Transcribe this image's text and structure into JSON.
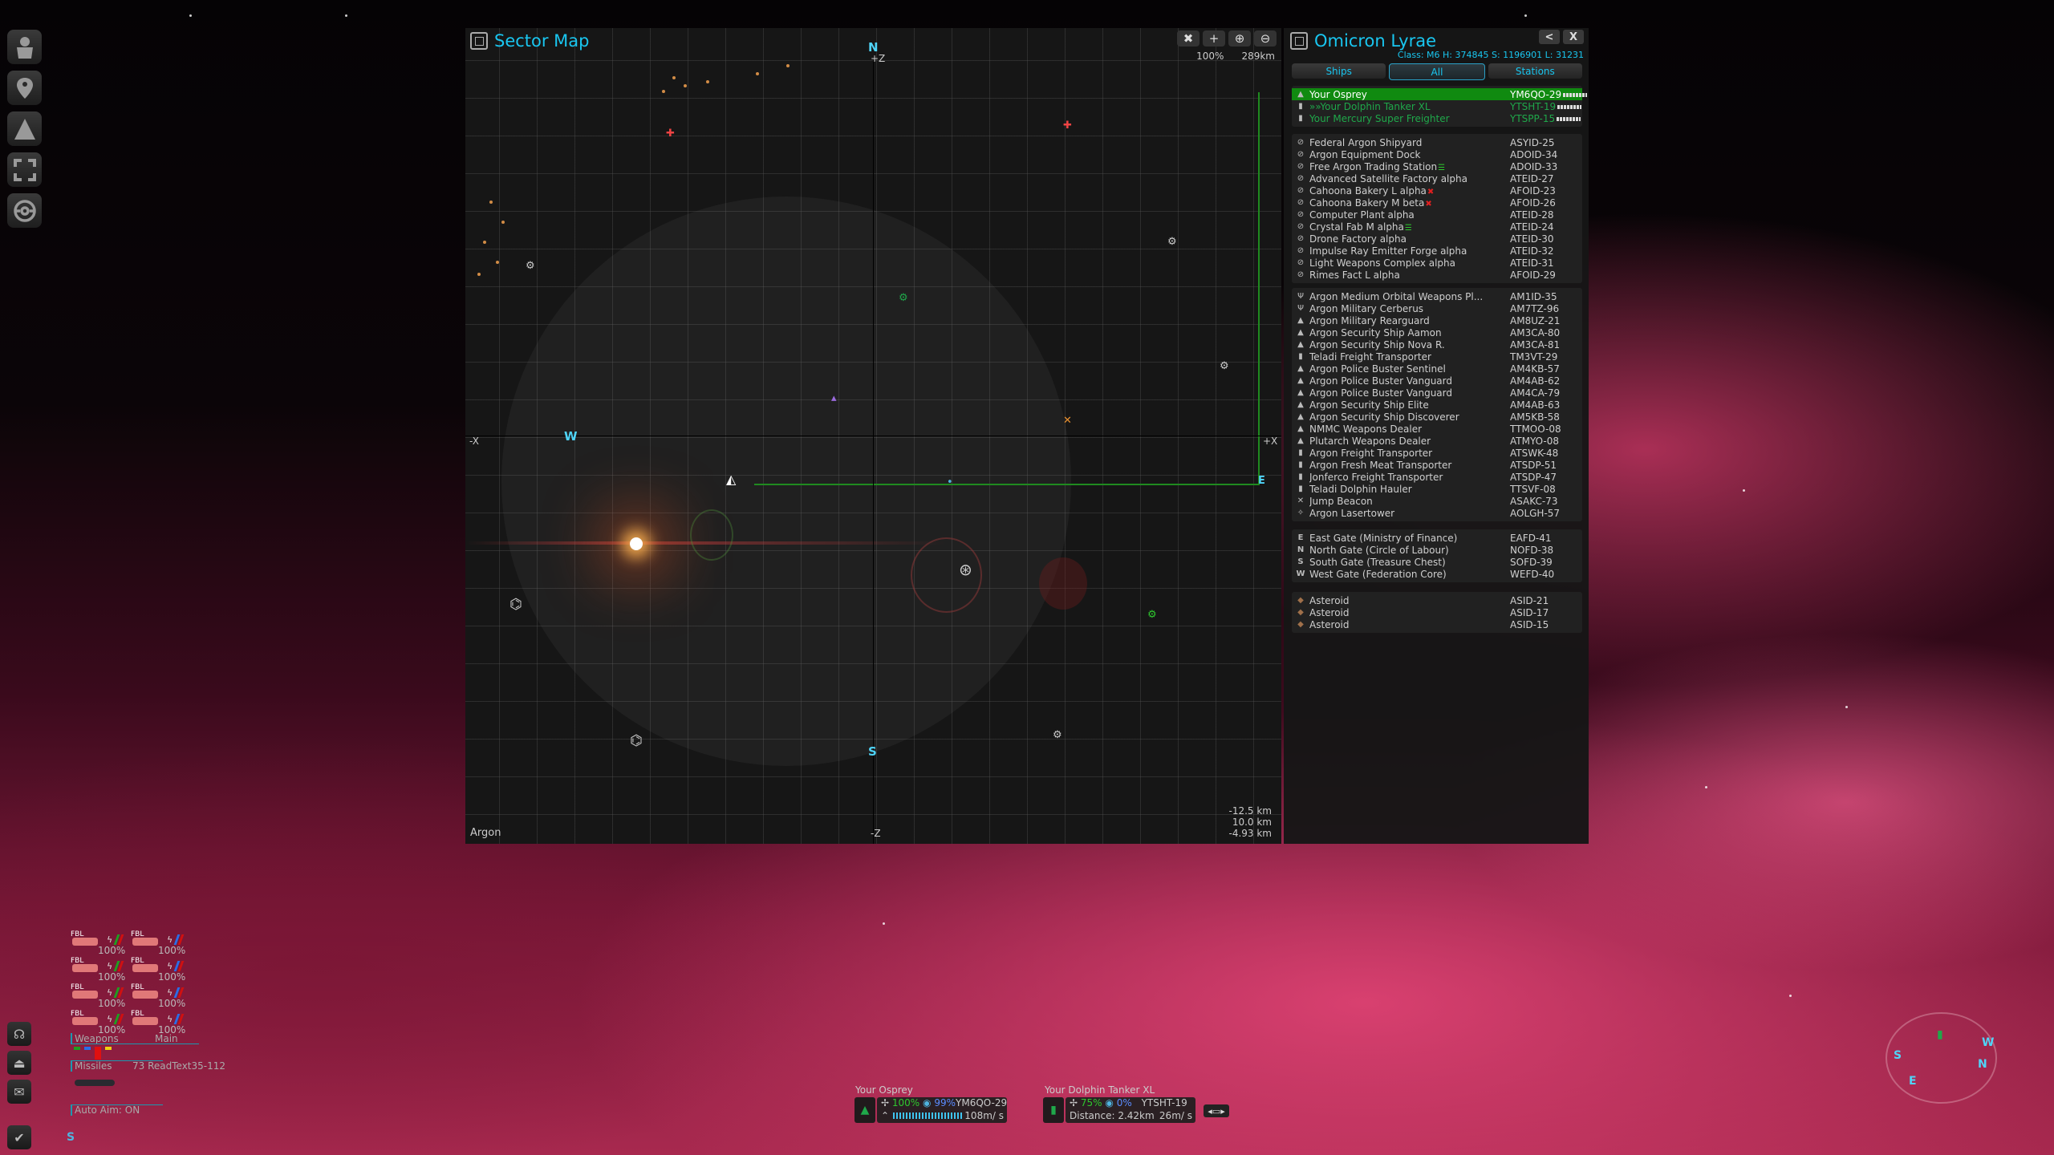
{
  "left_toolbar": [
    {
      "name": "pilot-icon"
    },
    {
      "name": "map-pin-icon"
    },
    {
      "name": "triangle-icon"
    },
    {
      "name": "fullscreen-icon"
    },
    {
      "name": "target-ring-icon"
    }
  ],
  "sector_map": {
    "title": "Sector Map",
    "tools": [
      {
        "name": "hide-camera-icon",
        "glyph": "✖"
      },
      {
        "name": "plus-icon",
        "glyph": "+"
      },
      {
        "name": "zoom-in-icon",
        "glyph": "⊕"
      },
      {
        "name": "zoom-out-icon",
        "glyph": "⊖"
      }
    ],
    "zoom_percent": "100%",
    "range": "289km",
    "axes": {
      "top": "+Z",
      "bottom": "-Z",
      "left": "-X",
      "right": "+X"
    },
    "gates": {
      "north": "N",
      "south": "S",
      "west": "W",
      "east": "E"
    },
    "sector_owner": "Argon",
    "position_readout": [
      "-12.5 km",
      "10.0 km",
      "-4.93 km"
    ]
  },
  "sector_panel": {
    "title": "Omicron Lyrae",
    "class_line": "Class: M6  H: 374845  S: 1196901  L: 31231",
    "nav": {
      "back": "<",
      "close": "X"
    },
    "tabs": [
      {
        "label": "Ships",
        "active": false
      },
      {
        "label": "All",
        "active": true
      },
      {
        "label": "Stations",
        "active": false
      }
    ],
    "owned": [
      {
        "name": "Your Osprey",
        "id": "YM6QO-29",
        "selected": true
      },
      {
        "name": "»»Your Dolphin Tanker XL",
        "id": "YTSHT-19",
        "selected": false
      },
      {
        "name": "Your Mercury Super Freighter",
        "id": "YTSPP-15",
        "selected": false
      }
    ],
    "stations": [
      {
        "name": "Federal Argon Shipyard",
        "id": "ASYID-25",
        "flag": ""
      },
      {
        "name": "Argon Equipment Dock",
        "id": "ADOID-34",
        "flag": ""
      },
      {
        "name": "Free Argon Trading Station",
        "id": "ADOID-33",
        "flag": "green"
      },
      {
        "name": "Advanced Satellite Factory alpha",
        "id": "ATEID-27",
        "flag": ""
      },
      {
        "name": "Cahoona Bakery L alpha",
        "id": "AFOID-23",
        "flag": "red"
      },
      {
        "name": "Cahoona Bakery M beta",
        "id": "AFOID-26",
        "flag": "red"
      },
      {
        "name": "Computer Plant alpha",
        "id": "ATEID-28",
        "flag": ""
      },
      {
        "name": "Crystal Fab M alpha",
        "id": "ATEID-24",
        "flag": "green"
      },
      {
        "name": "Drone Factory alpha",
        "id": "ATEID-30",
        "flag": ""
      },
      {
        "name": "Impulse Ray Emitter Forge alpha",
        "id": "ATEID-32",
        "flag": ""
      },
      {
        "name": "Light Weapons Complex alpha",
        "id": "ATEID-31",
        "flag": ""
      },
      {
        "name": "Rimes Fact L alpha",
        "id": "AFOID-29",
        "flag": ""
      }
    ],
    "ships": [
      {
        "name": "Argon Medium Orbital Weapons Pl...",
        "id": "AM1ID-35"
      },
      {
        "name": "Argon Military Cerberus",
        "id": "AM7TZ-96"
      },
      {
        "name": "Argon Military Rearguard",
        "id": "AM8UZ-21"
      },
      {
        "name": "Argon Security Ship Aamon",
        "id": "AM3CA-80"
      },
      {
        "name": "Argon Security Ship Nova R.",
        "id": "AM3CA-81"
      },
      {
        "name": "Teladi Freight Transporter",
        "id": "TM3VT-29"
      },
      {
        "name": "Argon Police Buster Sentinel",
        "id": "AM4KB-57"
      },
      {
        "name": "Argon Police Buster Vanguard",
        "id": "AM4AB-62"
      },
      {
        "name": "Argon Police Buster Vanguard",
        "id": "AM4CA-79"
      },
      {
        "name": "Argon Security Ship Elite",
        "id": "AM4AB-63"
      },
      {
        "name": "Argon Security Ship Discoverer",
        "id": "AM5KB-58"
      },
      {
        "name": "NMMC Weapons Dealer",
        "id": "TTMOO-08"
      },
      {
        "name": "Plutarch Weapons Dealer",
        "id": "ATMYO-08"
      },
      {
        "name": "Argon Freight Transporter",
        "id": "ATSWK-48"
      },
      {
        "name": "Argon Fresh Meat Transporter",
        "id": "ATSDP-51"
      },
      {
        "name": "Jonferco Freight Transporter",
        "id": "ATSDP-47"
      },
      {
        "name": "Teladi Dolphin Hauler",
        "id": "TTSVF-08"
      },
      {
        "name": "Jump Beacon",
        "id": "ASAKC-73"
      },
      {
        "name": "Argon Lasertower",
        "id": "AOLGH-57"
      }
    ],
    "gates": [
      {
        "letter": "E",
        "name": "East Gate (Ministry of Finance)",
        "id": "EAFD-41"
      },
      {
        "letter": "N",
        "name": "North Gate (Circle of Labour)",
        "id": "NOFD-38"
      },
      {
        "letter": "S",
        "name": "South Gate (Treasure Chest)",
        "id": "SOFD-39"
      },
      {
        "letter": "W",
        "name": "West Gate (Federation Core)",
        "id": "WEFD-40"
      }
    ],
    "asteroids": [
      {
        "name": "Asteroid",
        "id": "ASID-21"
      },
      {
        "name": "Asteroid",
        "id": "ASID-17"
      },
      {
        "name": "Asteroid",
        "id": "ASID-15"
      }
    ]
  },
  "weapons_hud": {
    "weapons": [
      {
        "label": "FBL",
        "pct": "100%",
        "group": "left"
      },
      {
        "label": "FBL",
        "pct": "100%",
        "group": "right"
      },
      {
        "label": "FBL",
        "pct": "100%",
        "group": "left"
      },
      {
        "label": "FBL",
        "pct": "100%",
        "group": "right"
      },
      {
        "label": "FBL",
        "pct": "100%",
        "group": "left"
      },
      {
        "label": "FBL",
        "pct": "100%",
        "group": "right"
      },
      {
        "label": "FBL",
        "pct": "100%",
        "group": "left"
      },
      {
        "label": "FBL",
        "pct": "100%",
        "group": "right"
      }
    ],
    "weapons_label": "Weapons",
    "main_label": "Main",
    "missiles_label": "Missiles",
    "missiles_value": "73 ReadText35-112",
    "auto_aim": "Auto Aim: ON",
    "compass_letter": "S"
  },
  "player_ship": {
    "name": "Your Osprey",
    "hull": "100%",
    "shield": "99%",
    "id": "YM6QO-29",
    "speed": "108m/ s",
    "throttle_fraction": 0.95
  },
  "target_ship": {
    "name": "Your Dolphin Tanker XL",
    "hull": "75%",
    "shield": "0%",
    "id": "YTSHT-19",
    "distance": "Distance: 2.42km",
    "speed": "26m/ s"
  },
  "radar_labels": [
    "S",
    "E",
    "W",
    "N"
  ],
  "bottom_left_icons": [
    "comms-icon",
    "eject-icon",
    "mail-icon",
    "check-icon"
  ]
}
